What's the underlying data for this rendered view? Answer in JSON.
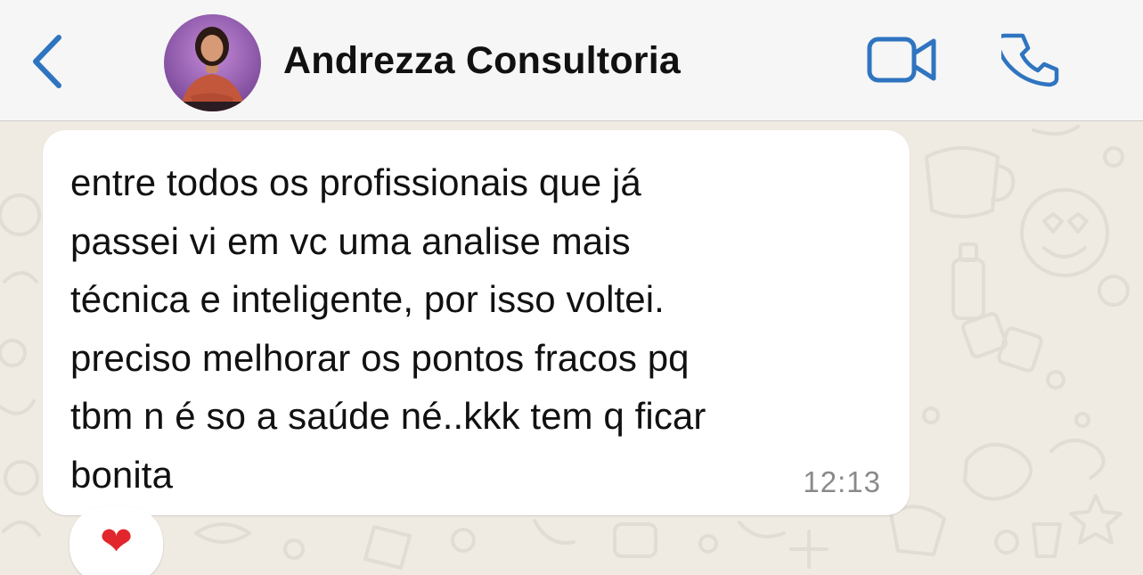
{
  "header": {
    "contact_name": "Andrezza Consultoria",
    "back_icon": "chevron-left-icon",
    "video_icon": "video-camera-icon",
    "call_icon": "phone-icon",
    "accent_color": "#2f74c0"
  },
  "message": {
    "text": "entre todos os profissionais que já\npassei vi em vc uma analise mais\ntécnica e inteligente, por isso voltei.\npreciso melhorar os pontos fracos pq\ntbm n é so a saúde né..kkk tem q ficar\nbonita",
    "time": "12:13",
    "reaction": "❤"
  },
  "colors": {
    "wallpaper": "#efeae2",
    "bubble": "#ffffff",
    "header_bg": "#f6f6f6",
    "reaction_heart": "#e2262d"
  }
}
